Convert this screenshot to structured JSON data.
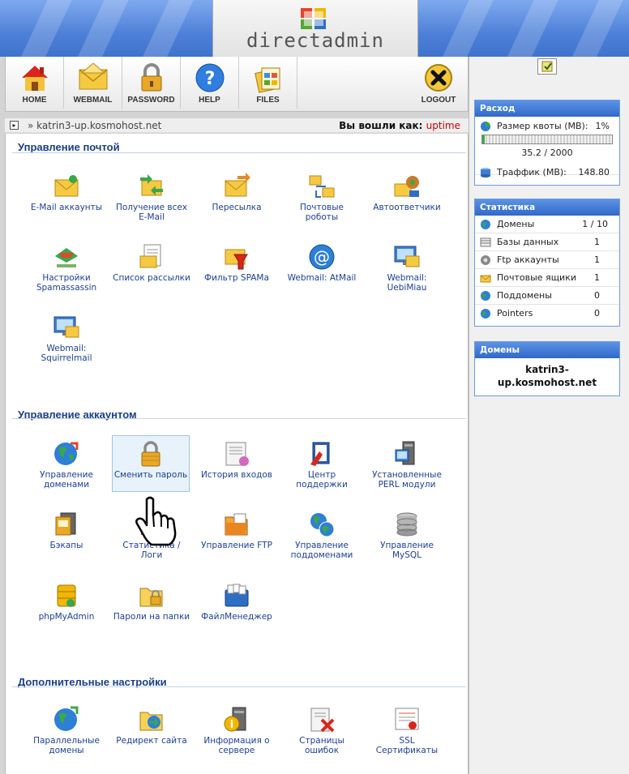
{
  "header": {
    "logo_text": "directadmin"
  },
  "toolbar": [
    {
      "key": "home",
      "label": "HOME",
      "icon": "home-icon"
    },
    {
      "key": "webmail",
      "label": "WEBMAIL",
      "icon": "envelope-icon"
    },
    {
      "key": "password",
      "label": "PASSWORD",
      "icon": "lock-icon"
    },
    {
      "key": "help",
      "label": "HELP",
      "icon": "help-icon"
    },
    {
      "key": "files",
      "label": "FILES",
      "icon": "files-icon"
    },
    {
      "key": "logout",
      "label": "LOGOUT",
      "icon": "close-icon"
    }
  ],
  "breadcrumb": {
    "path": "» katrin3-up.kosmohost.net",
    "logged_in_label": "Вы вошли как:",
    "user": "uptime"
  },
  "sections": {
    "mail": {
      "title": "Управление почтой",
      "items": [
        {
          "label": "E-Mail аккаунты",
          "icon": "email-accounts-icon"
        },
        {
          "label": "Получение всех E-Mail",
          "icon": "catch-all-icon"
        },
        {
          "label": "Пересылка",
          "icon": "forward-icon"
        },
        {
          "label": "Почтовые роботы",
          "icon": "mail-robots-icon"
        },
        {
          "label": "Автоответчики",
          "icon": "autoresponder-icon"
        },
        {
          "label": "Настройки Spamassassin",
          "icon": "spamassassin-icon"
        },
        {
          "label": "Список рассылки",
          "icon": "mailing-list-icon"
        },
        {
          "label": "Фильтр SPAMa",
          "icon": "spam-filter-icon"
        },
        {
          "label": "Webmail: AtMail",
          "icon": "atmail-icon"
        },
        {
          "label": "Webmail: UebiMiau",
          "icon": "uebimiau-icon"
        },
        {
          "label": "Webmail: Squirrelmail",
          "icon": "squirrelmail-icon"
        }
      ]
    },
    "account": {
      "title": "Управление аккаунтом",
      "items": [
        {
          "label": "Управление доменами",
          "icon": "domains-icon"
        },
        {
          "label": "Сменить пароль",
          "icon": "change-password-icon"
        },
        {
          "label": "История входов",
          "icon": "login-history-icon"
        },
        {
          "label": "Центр поддержки",
          "icon": "support-center-icon"
        },
        {
          "label": "Установленные PERL модули",
          "icon": "perl-modules-icon"
        },
        {
          "label": "Бэкапы",
          "icon": "backups-icon"
        },
        {
          "label": "Статистика / Логи",
          "icon": "statistics-icon"
        },
        {
          "label": "Управление FTP",
          "icon": "ftp-icon"
        },
        {
          "label": "Управление поддоменами",
          "icon": "subdomains-icon"
        },
        {
          "label": "Управление MySQL",
          "icon": "mysql-icon"
        },
        {
          "label": "phpMyAdmin",
          "icon": "phpmyadmin-icon"
        },
        {
          "label": "Пароли на папки",
          "icon": "folder-password-icon"
        },
        {
          "label": "ФайлМенеджер",
          "icon": "file-manager-icon"
        }
      ]
    },
    "extra": {
      "title": "Дополнительные настройки",
      "items": [
        {
          "label": "Параллельные домены",
          "icon": "parallel-domains-icon"
        },
        {
          "label": "Редирект сайта",
          "icon": "site-redirect-icon"
        },
        {
          "label": "Информация о сервере",
          "icon": "server-info-icon"
        },
        {
          "label": "Страницы ошибок",
          "icon": "error-pages-icon"
        },
        {
          "label": "SSL Сертификаты",
          "icon": "ssl-certificates-icon"
        }
      ]
    }
  },
  "usage": {
    "title": "Расход",
    "quota_label": "Размер квоты (MB):",
    "quota_percent": "1%",
    "quota_fraction": 0.0176,
    "quota_value": "35.2 / 2000",
    "traffic_label": "Траффик (MB):",
    "traffic_value": "148.80"
  },
  "stats": {
    "title": "Статистика",
    "rows": [
      {
        "label": "Домены",
        "value": "1 / 10",
        "icon": "globe-icon"
      },
      {
        "label": "Базы данных",
        "value": "1",
        "icon": "database-icon"
      },
      {
        "label": "Ftp аккаунты",
        "value": "1",
        "icon": "ftp-account-icon"
      },
      {
        "label": "Почтовые ящики",
        "value": "1",
        "icon": "mailbox-icon"
      },
      {
        "label": "Поддомены",
        "value": "0",
        "icon": "subdomain-icon"
      },
      {
        "label": "Pointers",
        "value": "0",
        "icon": "pointer-icon"
      }
    ]
  },
  "domains": {
    "title": "Домены",
    "domain": "katrin3-up.kosmohost.net"
  },
  "colors": {
    "header_blue": "#4d80d8",
    "section_title": "#1a3e8a",
    "link_blue": "#1d3f96",
    "user_red": "#d00000"
  }
}
